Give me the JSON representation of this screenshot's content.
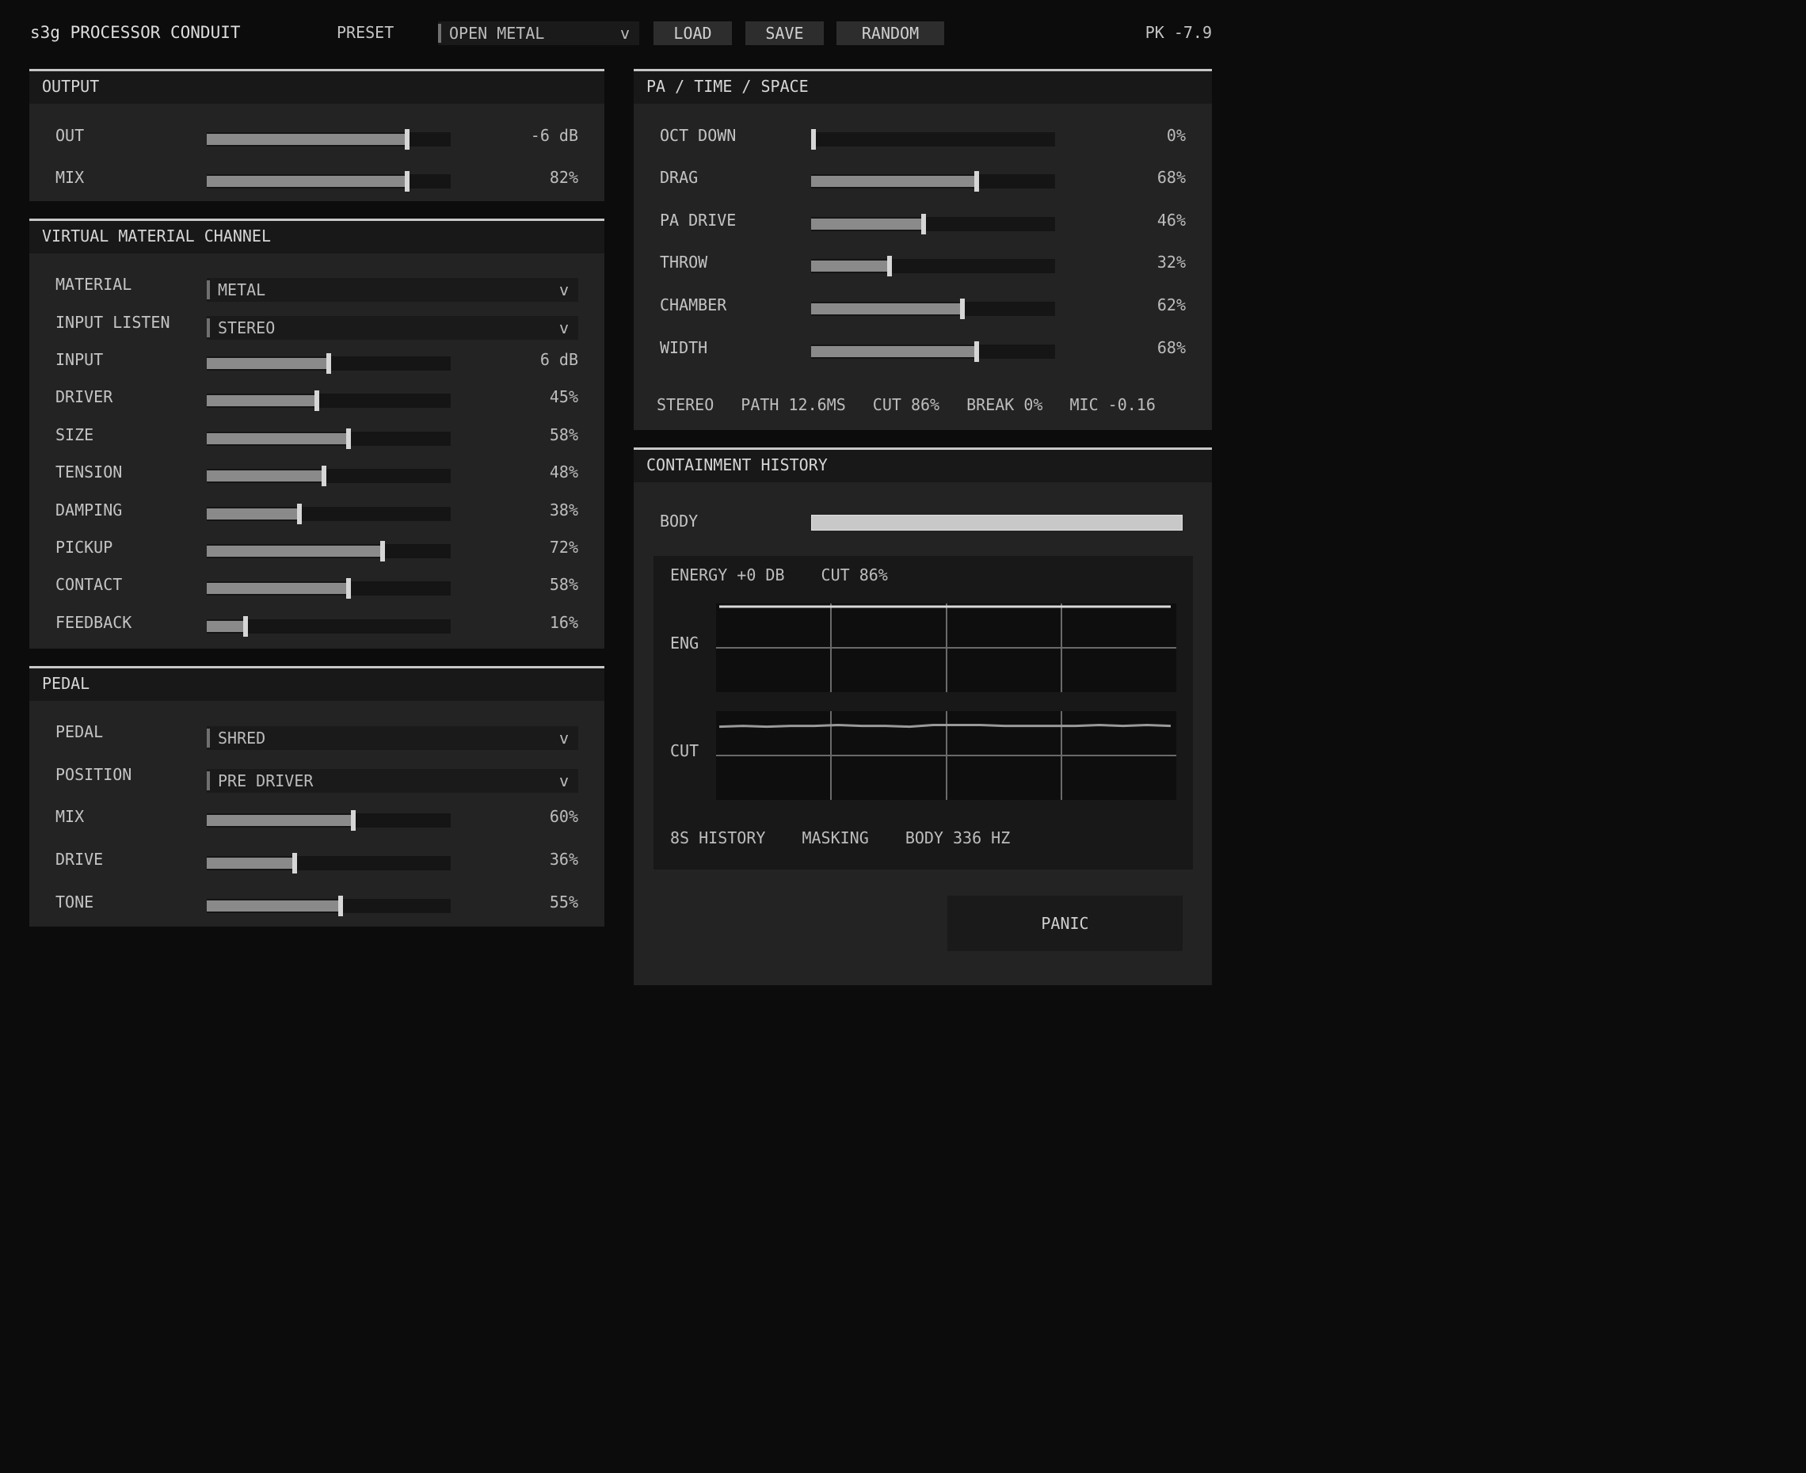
{
  "header": {
    "title": "s3g PROCESSOR CONDUIT",
    "preset_label": "PRESET",
    "preset_value": "OPEN METAL",
    "chevron": "v",
    "load": "LOAD",
    "save": "SAVE",
    "random": "RANDOM",
    "peak": "PK -7.9"
  },
  "output": {
    "title": "OUTPUT",
    "rows": [
      {
        "label": "OUT",
        "value": "-6 dB",
        "level": 0.82
      },
      {
        "label": "MIX",
        "value": "82%",
        "level": 0.82
      }
    ]
  },
  "vmc": {
    "title": "VIRTUAL MATERIAL CHANNEL",
    "selects": [
      {
        "label": "MATERIAL",
        "value": "METAL"
      },
      {
        "label": "INPUT LISTEN",
        "value": "STEREO"
      }
    ],
    "rows": [
      {
        "label": "INPUT",
        "value": "6 dB",
        "level": 0.5
      },
      {
        "label": "DRIVER",
        "value": "45%",
        "level": 0.45
      },
      {
        "label": "SIZE",
        "value": "58%",
        "level": 0.58
      },
      {
        "label": "TENSION",
        "value": "48%",
        "level": 0.48
      },
      {
        "label": "DAMPING",
        "value": "38%",
        "level": 0.38
      },
      {
        "label": "PICKUP",
        "value": "72%",
        "level": 0.72
      },
      {
        "label": "CONTACT",
        "value": "58%",
        "level": 0.58
      },
      {
        "label": "FEEDBACK",
        "value": "16%",
        "level": 0.16
      }
    ]
  },
  "pedal": {
    "title": "PEDAL",
    "selects": [
      {
        "label": "PEDAL",
        "value": "SHRED"
      },
      {
        "label": "POSITION",
        "value": "PRE DRIVER"
      }
    ],
    "rows": [
      {
        "label": "MIX",
        "value": "60%",
        "level": 0.6
      },
      {
        "label": "DRIVE",
        "value": "36%",
        "level": 0.36
      },
      {
        "label": "TONE",
        "value": "55%",
        "level": 0.55
      }
    ]
  },
  "pa": {
    "title": "PA / TIME / SPACE",
    "rows": [
      {
        "label": "OCT DOWN",
        "value": "0%",
        "level": 0.0
      },
      {
        "label": "DRAG",
        "value": "68%",
        "level": 0.68
      },
      {
        "label": "PA DRIVE",
        "value": "46%",
        "level": 0.46
      },
      {
        "label": "THROW",
        "value": "32%",
        "level": 0.32
      },
      {
        "label": "CHAMBER",
        "value": "62%",
        "level": 0.62
      },
      {
        "label": "WIDTH",
        "value": "68%",
        "level": 0.68
      }
    ],
    "status": [
      "STEREO",
      "PATH 12.6MS",
      "CUT 86%",
      "BREAK 0%",
      "MIC -0.16"
    ]
  },
  "history": {
    "title": "CONTAINMENT HISTORY",
    "body_label": "BODY",
    "body_level": 1.0,
    "stats": [
      "ENERGY +0 DB",
      "CUT 86%"
    ],
    "eng_label": "ENG",
    "cut_label": "CUT",
    "eng_trace": [
      1.0,
      1.0,
      1.0,
      1.0,
      1.0,
      1.0,
      1.0,
      1.0,
      1.0,
      1.0,
      1.0,
      1.0,
      1.0,
      1.0,
      1.0,
      1.0,
      1.0,
      1.0,
      1.0,
      1.0
    ],
    "cut_trace": [
      0.85,
      0.86,
      0.85,
      0.86,
      0.86,
      0.87,
      0.86,
      0.86,
      0.85,
      0.87,
      0.87,
      0.87,
      0.86,
      0.86,
      0.86,
      0.86,
      0.87,
      0.86,
      0.87,
      0.86
    ],
    "footer": [
      "8S HISTORY",
      "MASKING",
      "BODY 336 HZ"
    ],
    "panic": "PANIC"
  }
}
